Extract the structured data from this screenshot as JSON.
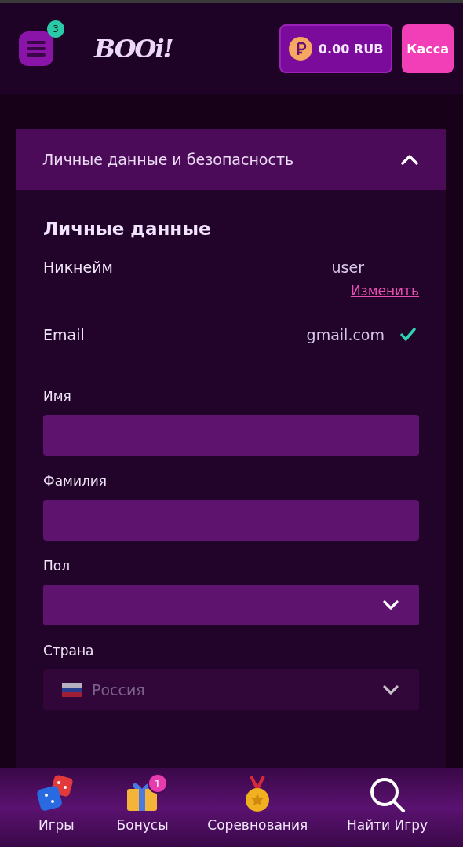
{
  "header": {
    "menu_badge": "3",
    "logo": "BOOi!",
    "balance": "0.00 RUB",
    "cashier_button": "Касса"
  },
  "section": {
    "title": "Личные данные и безопасность",
    "expanded": true,
    "heading": "Личные данные",
    "info_rows": [
      {
        "label": "Никнейм",
        "value": "user",
        "link": "Изменить",
        "verified": false
      },
      {
        "label": "Email",
        "value": "gmail.com",
        "verified": true
      }
    ],
    "fields": [
      {
        "kind": "text",
        "label": "Имя",
        "disabled": false
      },
      {
        "kind": "text",
        "label": "Фамилия",
        "disabled": false
      },
      {
        "kind": "select",
        "label": "Пол",
        "disabled": false
      },
      {
        "kind": "select",
        "label": "Страна",
        "value": "Россия",
        "flag": true,
        "disabled": true
      }
    ]
  },
  "bottom_nav": [
    {
      "kind": "dice",
      "label": "Игры"
    },
    {
      "kind": "gift",
      "label": "Бонусы",
      "badge": "1"
    },
    {
      "kind": "medal",
      "label": "Соревнования"
    },
    {
      "kind": "search",
      "label": "Найти Игру"
    }
  ]
}
